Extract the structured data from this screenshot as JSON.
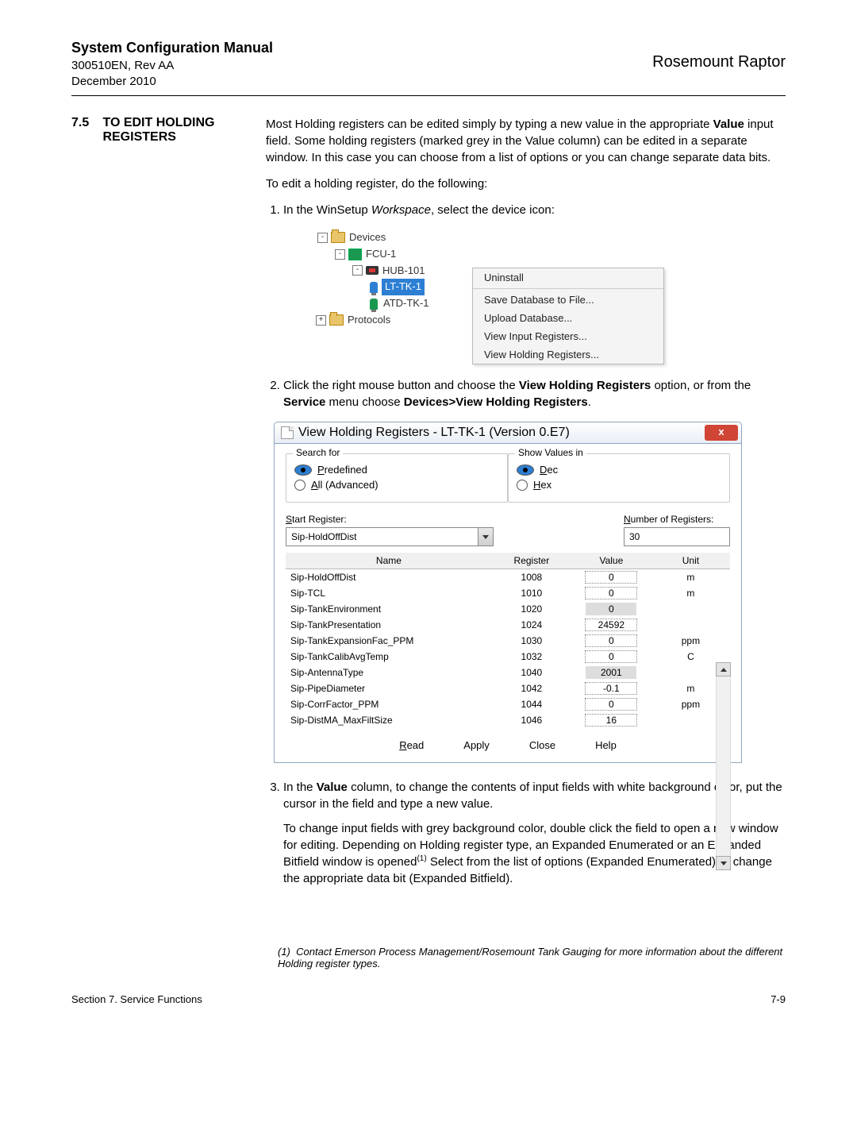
{
  "header": {
    "title": "System Configuration Manual",
    "doc_id": "300510EN, Rev AA",
    "date": "December 2010",
    "product": "Rosemount Raptor"
  },
  "section": {
    "num": "7.5",
    "title": "TO EDIT HOLDING REGISTERS"
  },
  "para": {
    "p1a": "Most Holding registers can be edited simply by typing a new value in the appropriate ",
    "p1b": "Value",
    "p1c": " input field. Some holding registers (marked grey in the Value column) can be edited in a separate window. In this case you can choose from a list of options or you can change separate data bits.",
    "p2": "To edit a holding register, do the following:",
    "s1a": "In the WinSetup ",
    "s1b": "Workspace",
    "s1c": ", select the device icon:",
    "s2a": "Click the right mouse button and choose the ",
    "s2b": "View Holding Registers",
    "s2c": " option, or from the ",
    "s2d": "Service",
    "s2e": " menu choose ",
    "s2f": "Devices>View Holding Registers",
    "s2g": ".",
    "s3a": "In the ",
    "s3b": "Value",
    "s3c": " column, to change the contents of input fields with white background color, put the cursor in the field and type a new value.",
    "s3p2": "To change input fields with grey background color, double click the field to open a new window for editing. Depending on Holding register type, an Expanded Enumerated or an Expanded Bitfield window is opened",
    "s3p2sup": "(1)",
    "s3p3": " Select from the list of options (Expanded Enumerated) or change the appropriate data bit (Expanded Bitfield)."
  },
  "tree": {
    "devices": "Devices",
    "fcu": "FCU-1",
    "hub": "HUB-101",
    "lt": "LT-TK-1",
    "atd": "ATD-TK-1",
    "protocols": "Protocols"
  },
  "ctx": {
    "uninstall": "Uninstall",
    "save": "Save Database to File...",
    "upload": "Upload Database...",
    "vir": "View Input Registers...",
    "vhr": "View Holding Registers..."
  },
  "dialog": {
    "title": "View Holding Registers - LT-TK-1 (Version 0.E7)",
    "search_for": "Search for",
    "predefined": "Predefined",
    "all_adv": "All (Advanced)",
    "show_values": "Show Values in",
    "dec": "Dec",
    "hex": "Hex",
    "start_reg": "Start Register:",
    "num_reg": "Number of Registers:",
    "start_val": "Sip-HoldOffDist",
    "num_val": "30",
    "cols": {
      "name": "Name",
      "register": "Register",
      "value": "Value",
      "unit": "Unit"
    },
    "rows": [
      {
        "name": "Sip-HoldOffDist",
        "reg": "1008",
        "val": "0",
        "unit": "m",
        "grey": false
      },
      {
        "name": "Sip-TCL",
        "reg": "1010",
        "val": "0",
        "unit": "m",
        "grey": false
      },
      {
        "name": "Sip-TankEnvironment",
        "reg": "1020",
        "val": "0",
        "unit": "",
        "grey": true
      },
      {
        "name": "Sip-TankPresentation",
        "reg": "1024",
        "val": "24592",
        "unit": "",
        "grey": false
      },
      {
        "name": "Sip-TankExpansionFac_PPM",
        "reg": "1030",
        "val": "0",
        "unit": "ppm",
        "grey": false
      },
      {
        "name": "Sip-TankCalibAvgTemp",
        "reg": "1032",
        "val": "0",
        "unit": "C",
        "grey": false
      },
      {
        "name": "Sip-AntennaType",
        "reg": "1040",
        "val": "2001",
        "unit": "",
        "grey": true
      },
      {
        "name": "Sip-PipeDiameter",
        "reg": "1042",
        "val": "-0.1",
        "unit": "m",
        "grey": false
      },
      {
        "name": "Sip-CorrFactor_PPM",
        "reg": "1044",
        "val": "0",
        "unit": "ppm",
        "grey": false
      },
      {
        "name": "Sip-DistMA_MaxFiltSize",
        "reg": "1046",
        "val": "16",
        "unit": "",
        "grey": false
      }
    ],
    "buttons": {
      "read": "Read",
      "apply": "Apply",
      "close": "Close",
      "help": "Help"
    }
  },
  "footnote": {
    "marker": "(1)",
    "text": "Contact Emerson Process Management/Rosemount Tank Gauging for more information about the different Holding register types."
  },
  "footer": {
    "left": "Section 7. Service Functions",
    "right": "7-9"
  }
}
